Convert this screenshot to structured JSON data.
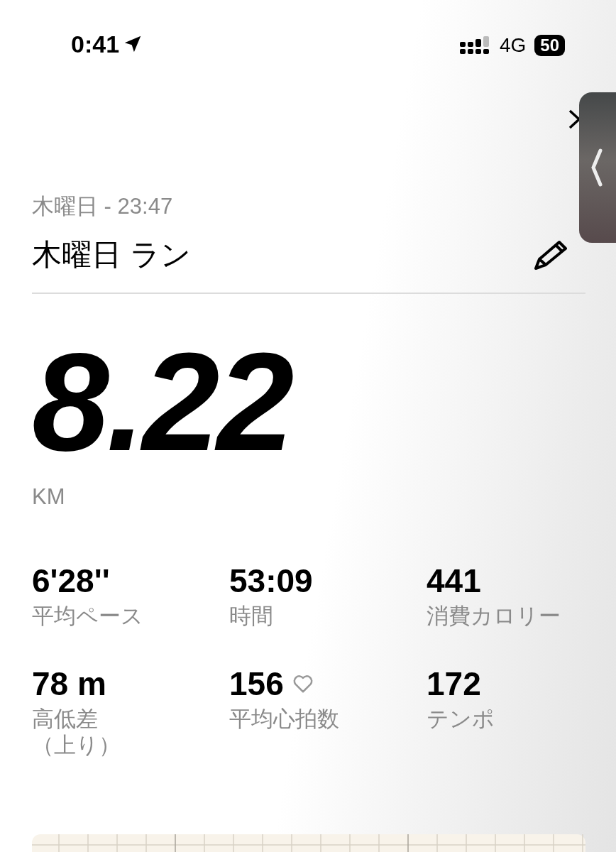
{
  "status_bar": {
    "time": "0:41",
    "network": "4G",
    "battery": "50"
  },
  "header": {
    "date_time": "木曜日 - 23:47",
    "title": "木曜日 ラン"
  },
  "distance": {
    "value": "8.22",
    "unit": "KM"
  },
  "stats": [
    {
      "kind": "plain",
      "value": "6'28''",
      "label": "平均ペース"
    },
    {
      "kind": "plain",
      "value": "53:09",
      "label": "時間"
    },
    {
      "kind": "plain",
      "value": "441",
      "label": "消費カロリー"
    },
    {
      "kind": "plain",
      "value": "78 m",
      "label": "高低差",
      "label_note": "（上り）"
    },
    {
      "kind": "heart_rate",
      "value": "156",
      "label": "平均心拍数"
    },
    {
      "kind": "plain",
      "value": "172",
      "label": "テンポ"
    }
  ]
}
